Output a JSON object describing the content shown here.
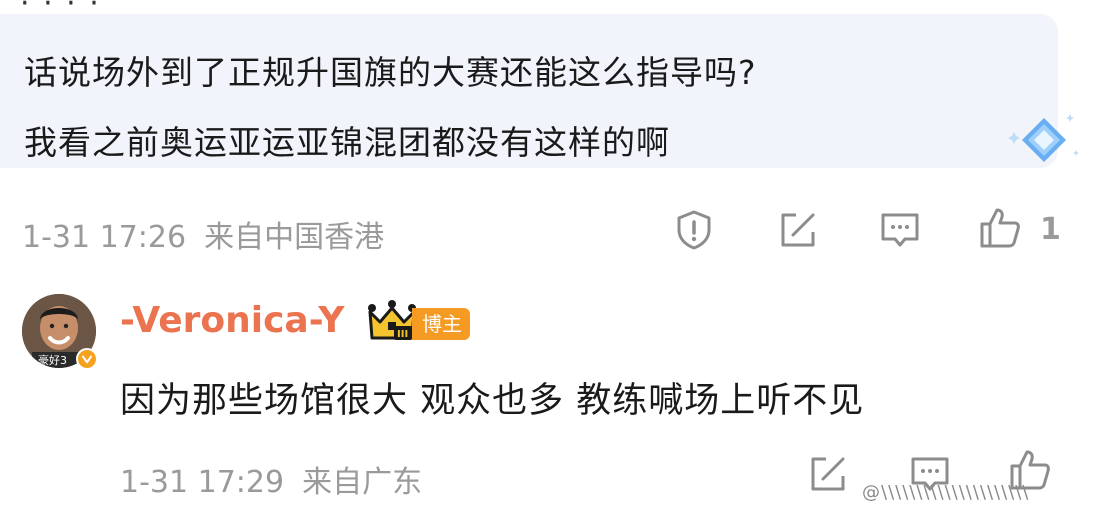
{
  "previous_comment": {
    "quote_line1": "话说场外到了正规升国旗的大赛还能这么指导吗?",
    "quote_line2": "我看之前奥运亚运亚锦混团都没有这样的啊",
    "time": "1-31 17:26",
    "location": "来自中国香港",
    "like_count": "1",
    "actions": [
      "report-icon",
      "edit-icon",
      "comment-icon",
      "like-icon"
    ]
  },
  "reply": {
    "username": "-Veronica-Y",
    "role_tag": "博主",
    "text": "因为那些场馆很大 观众也多 教练喊场上听不见",
    "time": "1-31 17:29",
    "location": "来自广东",
    "avatar_caption": "豪好3",
    "actions": [
      "edit-icon",
      "comment-icon",
      "like-icon"
    ]
  },
  "colors": {
    "username": "#eb7350",
    "tag": "#f59a23",
    "meta": "#9a9a9a",
    "bubble": "#f1f4fb"
  }
}
